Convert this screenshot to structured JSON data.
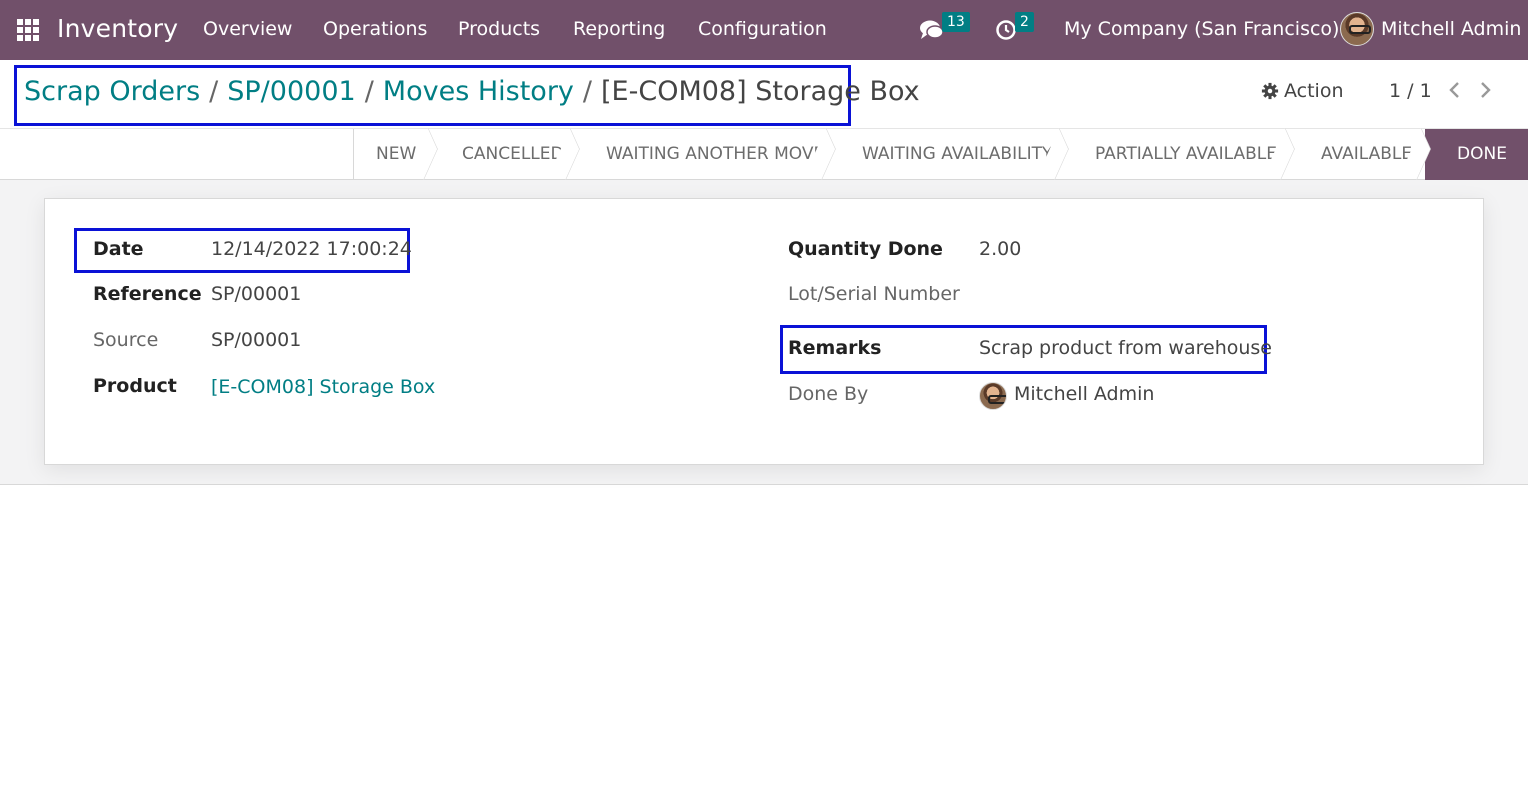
{
  "navbar": {
    "app_name": "Inventory",
    "menus": [
      "Overview",
      "Operations",
      "Products",
      "Reporting",
      "Configuration"
    ],
    "messages_count": "13",
    "activities_count": "2",
    "company": "My Company (San Francisco)",
    "user_name": "Mitchell Admin",
    "colors": {
      "navbar": "#71506a",
      "badge": "#017e84"
    }
  },
  "breadcrumb": {
    "items": [
      "Scrap Orders",
      "SP/00001",
      "Moves History"
    ],
    "current": "[E-COM08] Storage Box",
    "separator": "/"
  },
  "control": {
    "action_label": "Action",
    "pager": "1 / 1"
  },
  "statusbar": {
    "stages": [
      "NEW",
      "CANCELLED",
      "WAITING ANOTHER MOVE",
      "WAITING AVAILABILITY",
      "PARTIALLY AVAILABLE",
      "AVAILABLE",
      "DONE"
    ],
    "active": "DONE"
  },
  "form": {
    "left": {
      "date_label": "Date",
      "date_value": "12/14/2022 17:00:24",
      "reference_label": "Reference",
      "reference_value": "SP/00001",
      "source_label": "Source",
      "source_value": "SP/00001",
      "product_label": "Product",
      "product_value": "[E-COM08] Storage Box"
    },
    "right": {
      "qty_label": "Quantity Done",
      "qty_value": "2.00",
      "lot_label": "Lot/Serial Number",
      "lot_value": "",
      "remarks_label": "Remarks",
      "remarks_value": "Scrap product from warehouse",
      "doneby_label": "Done By",
      "doneby_value": "Mitchell Admin"
    }
  }
}
